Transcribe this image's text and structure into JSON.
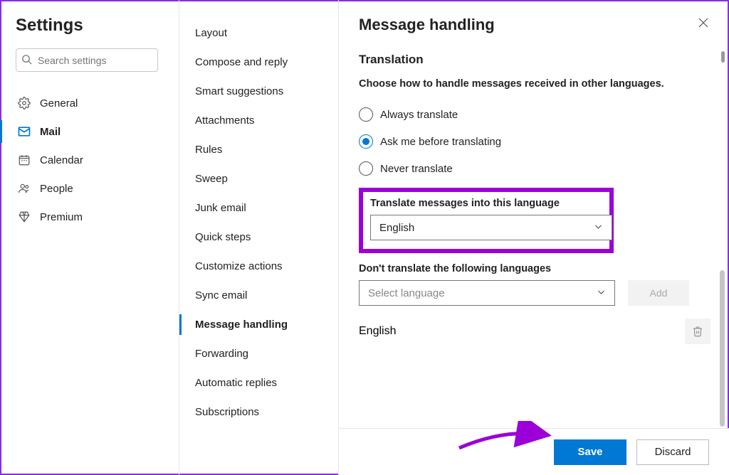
{
  "sidebar": {
    "title": "Settings",
    "search_placeholder": "Search settings",
    "items": [
      {
        "label": "General",
        "icon": "gear"
      },
      {
        "label": "Mail",
        "icon": "mail",
        "selected": true
      },
      {
        "label": "Calendar",
        "icon": "calendar"
      },
      {
        "label": "People",
        "icon": "people"
      },
      {
        "label": "Premium",
        "icon": "premium"
      }
    ]
  },
  "subnav": {
    "items": [
      "Layout",
      "Compose and reply",
      "Smart suggestions",
      "Attachments",
      "Rules",
      "Sweep",
      "Junk email",
      "Quick steps",
      "Customize actions",
      "Sync email",
      "Message handling",
      "Forwarding",
      "Automatic replies",
      "Subscriptions"
    ],
    "selected": "Message handling"
  },
  "main": {
    "title": "Message handling",
    "section_title": "Translation",
    "description": "Choose how to handle messages received in other languages.",
    "radio_options": [
      {
        "label": "Always translate",
        "checked": false
      },
      {
        "label": "Ask me before translating",
        "checked": true
      },
      {
        "label": "Never translate",
        "checked": false
      }
    ],
    "translate_into_label": "Translate messages into this language",
    "translate_into_value": "English",
    "dont_translate_label": "Don't translate the following languages",
    "dont_translate_placeholder": "Select language",
    "add_button": "Add",
    "excluded_languages": [
      "English"
    ],
    "save_button": "Save",
    "discard_button": "Discard"
  }
}
